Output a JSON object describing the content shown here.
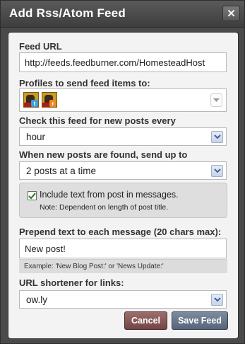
{
  "dialog": {
    "title": "Add Rss/Atom Feed",
    "close_glyph": "✕"
  },
  "feed_url": {
    "label": "Feed URL",
    "value": "http://feeds.feedburner.com/HomesteadHost"
  },
  "profiles": {
    "label": "Profiles to send feed items to:",
    "items": [
      {
        "icon": "twitter-badge",
        "badge_color": "#3b9fd9",
        "badge_glyph": "t"
      },
      {
        "icon": "rss-badge",
        "badge_color": "#f08a24",
        "badge_glyph": "r"
      }
    ]
  },
  "check_frequency": {
    "label": "Check this feed for new posts every",
    "selected": "hour"
  },
  "send_up_to": {
    "label": "When new posts are found, send up to",
    "selected": "2 posts at a time"
  },
  "include_text": {
    "checked": true,
    "label": "Include text from post in messages.",
    "note": "Note: Dependent on length of post title."
  },
  "prepend": {
    "label": "Prepend text to each message (20 chars max):",
    "value": "New post!",
    "example": "Example: 'New Blog Post:' or 'News Update:'"
  },
  "url_shortener": {
    "label": "URL shortener for links:",
    "selected": "ow.ly"
  },
  "buttons": {
    "cancel": "Cancel",
    "save": "Save Feed"
  },
  "colors": {
    "cancel_button": "#7f5151",
    "save_button": "#5f6e82",
    "select_arrow": "#3b5fa8"
  }
}
